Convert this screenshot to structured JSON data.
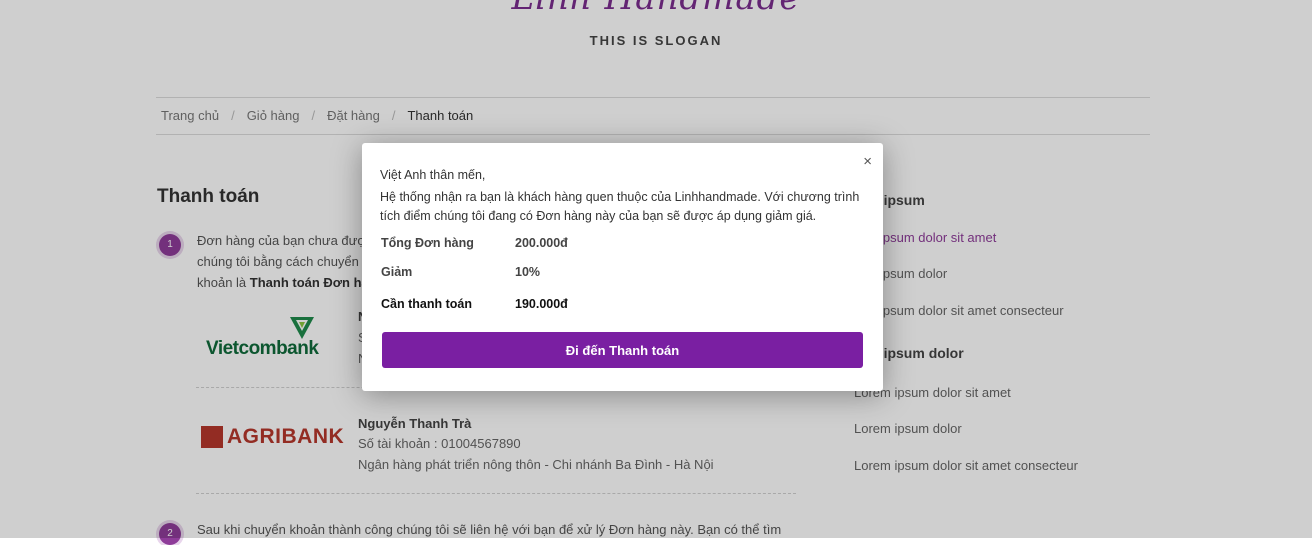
{
  "header": {
    "logo_text": "Linh Handmade",
    "slogan": "THIS IS SLOGAN"
  },
  "breadcrumb": [
    "Trang chủ",
    "Giỏ hàng",
    "Đặt hàng",
    "Thanh toán"
  ],
  "main": {
    "title": "Thanh toán",
    "step1": {
      "number": "1",
      "line1": "Đơn hàng của bạn chưa được",
      "line2": "chúng tôi bằng cách chuyển",
      "line3_prefix": "khoản là ",
      "line3_bold": "Thanh toán Đơn hà"
    },
    "accounts": [
      {
        "bank_logo": "Vietcombank",
        "name": "N",
        "number_label": "S",
        "branch": "N"
      },
      {
        "bank_logo": "AGRIBANK",
        "name": "Nguyễn Thanh Trà",
        "number_label": "Số tài khoản : 01004567890",
        "branch": "Ngân hàng phát triển nông thôn - Chi nhánh Ba Đình - Hà Nội"
      }
    ],
    "step2": {
      "number": "2",
      "text": "Sau khi chuyển khoản thành công chúng tôi sẽ liên hệ với bạn để xử lý Đơn hàng này. Bạn có thể tìm"
    }
  },
  "sidebar": {
    "group1_title": "rem ipsum",
    "group1_items": [
      "rem ipsum dolor sit amet",
      "rem ipsum dolor",
      "rem ipsum dolor sit amet consecteur"
    ],
    "group2_title": "rem ipsum dolor",
    "group2_items": [
      "Lorem ipsum dolor sit amet",
      "Lorem ipsum dolor",
      "Lorem ipsum dolor sit amet consecteur"
    ]
  },
  "modal": {
    "close_icon": "×",
    "greeting": "Việt Anh thân mến,",
    "message": "Hệ thống nhận ra bạn là khách hàng quen thuộc của Linhhandmade. Với chương trình tích điểm chúng tôi đang có Đơn hàng này của bạn sẽ được áp dụng giảm giá.",
    "rows": [
      {
        "label": "Tổng Đơn hàng",
        "value": "200.000đ"
      },
      {
        "label": "Giảm",
        "value": "10%"
      },
      {
        "label": "Cần thanh toán",
        "value": "190.000đ"
      }
    ],
    "button_label": "Đi đến Thanh toán"
  },
  "colors": {
    "accent": "#7a1fa2",
    "brand_purple": "#8e3c99"
  }
}
